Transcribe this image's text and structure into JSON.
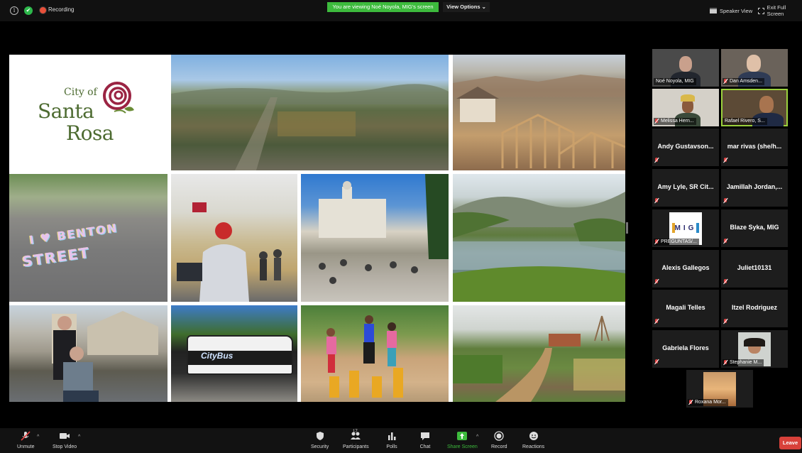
{
  "topbar": {
    "recording_label": "Recording",
    "viewing_banner": "You are viewing Noé Noyola, MIG's screen",
    "view_options": "View Options ⌄",
    "speaker_view": "Speaker View",
    "exit_full_screen": "Exit Full Screen"
  },
  "shared_screen": {
    "logo": {
      "line1": "City of",
      "line2": "Santa",
      "line3": "Rosa"
    },
    "chalk_text": {
      "line1": "I ♥ BENTON",
      "line2": "STREET"
    },
    "bus_text": "CityBus"
  },
  "participants": [
    {
      "name": "Noé Noyola, MIG",
      "video": true,
      "muted": false
    },
    {
      "name": "Dan Amsden...",
      "video": true,
      "muted": true
    },
    {
      "name": "Melissa Hern...",
      "video": true,
      "muted": true
    },
    {
      "name": "Rafael Rivero, S...",
      "video": true,
      "muted": false,
      "active": true
    },
    {
      "name": "Andy Gustavson...",
      "video": false,
      "muted": true
    },
    {
      "name": "mar rivas (she/h...",
      "video": false,
      "muted": true
    },
    {
      "name": "Amy Lyle, SR Cit...",
      "video": false,
      "muted": true
    },
    {
      "name": "Jamillah Jordan,...",
      "video": false,
      "muted": true
    },
    {
      "name": "PREGUNTAS/...",
      "video": true,
      "muted": true,
      "logo": "MIG"
    },
    {
      "name": "Blaze Syka, MIG",
      "video": false,
      "muted": true
    },
    {
      "name": "Alexis Gallegos",
      "video": false,
      "muted": true
    },
    {
      "name": "Juliet10131",
      "video": false,
      "muted": true
    },
    {
      "name": "Magali Telles",
      "video": false,
      "muted": true
    },
    {
      "name": "Itzel Rodriguez",
      "video": false,
      "muted": true
    },
    {
      "name": "Gabriela Flores",
      "video": false,
      "muted": true
    },
    {
      "name": "Stephanie M...",
      "video": true,
      "muted": true
    },
    {
      "name": "Roxana Mor...",
      "video": true,
      "muted": true
    }
  ],
  "toolbar": {
    "unmute": "Unmute",
    "stop_video": "Stop Video",
    "security": "Security",
    "participants": "Participants",
    "participants_count": "17",
    "polls": "Polls",
    "chat": "Chat",
    "share_screen": "Share Screen",
    "record": "Record",
    "reactions": "Reactions",
    "leave": "Leave"
  },
  "colors": {
    "accent_green": "#3dbb3d",
    "leave_red": "#d8413a",
    "active_speaker": "#9bd13d",
    "logo_green": "#4d6b31",
    "logo_rose": "#9b2443"
  }
}
